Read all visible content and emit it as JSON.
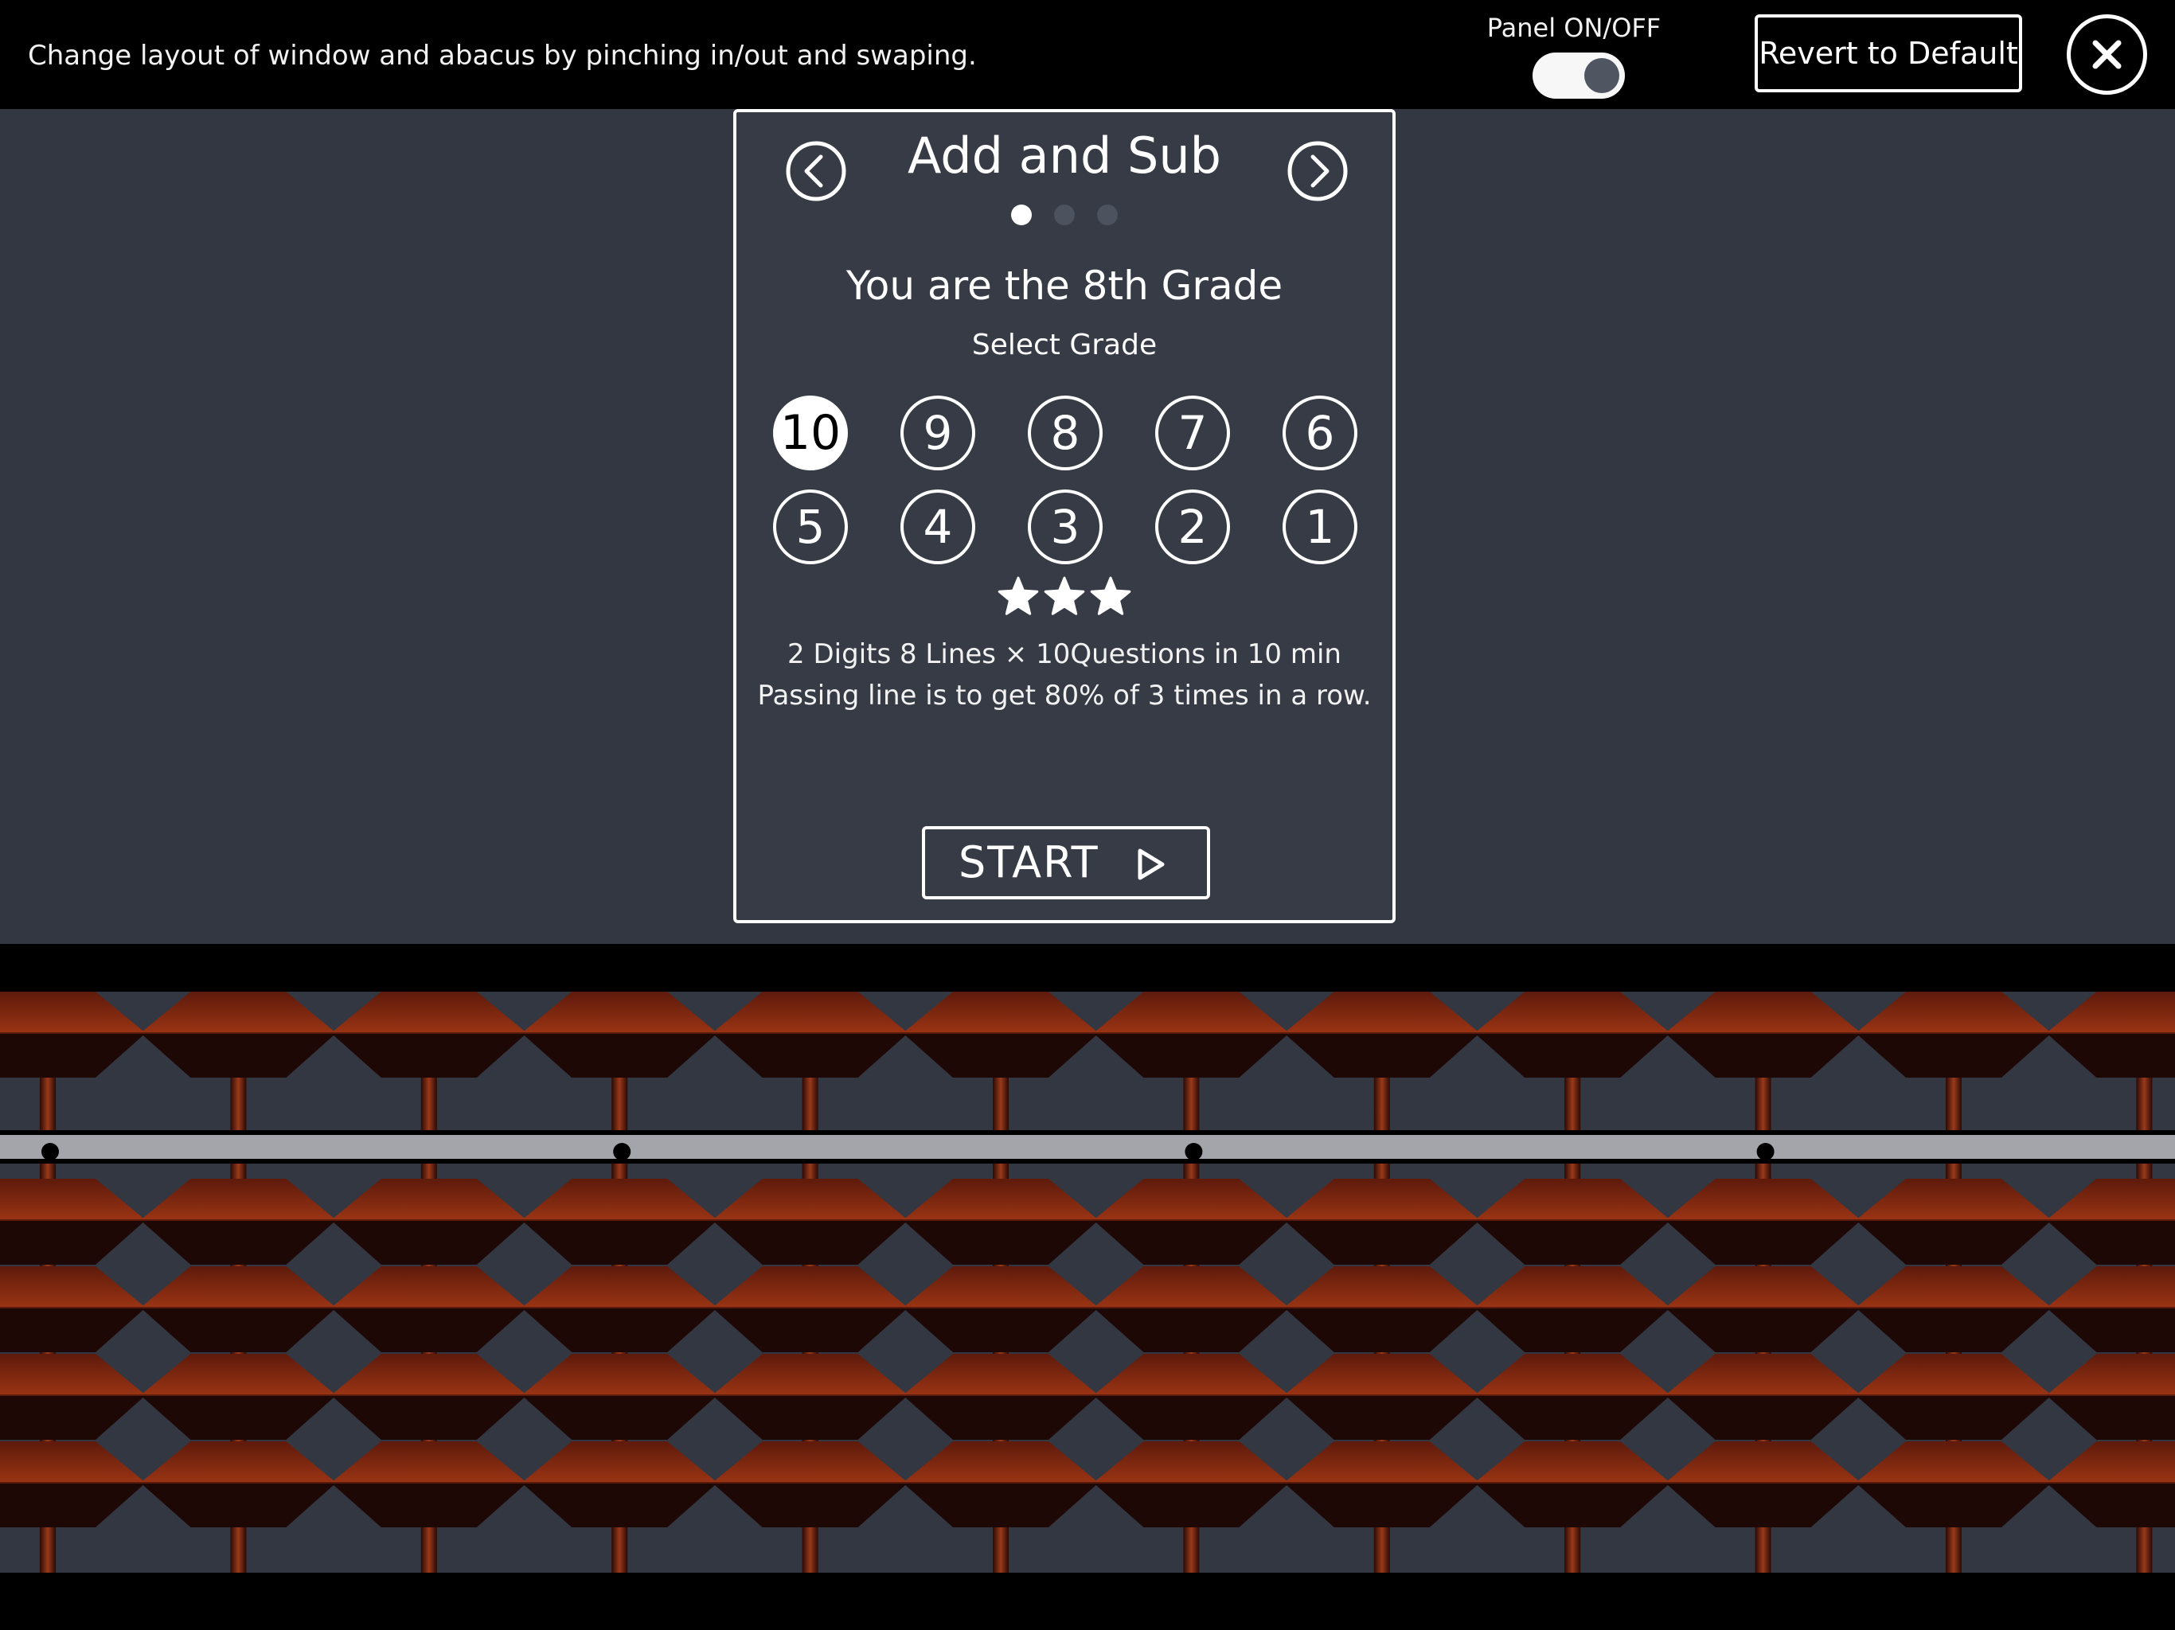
{
  "topbar": {
    "hint": "Change layout of window and abacus by pinching in/out and swaping.",
    "panel_label": "Panel ON/OFF",
    "panel_on": true,
    "revert_label": "Revert to Default",
    "close_icon": "close-icon"
  },
  "card": {
    "title": "Add and Sub",
    "page_count": 3,
    "active_page": 1,
    "grade_heading": "You are the 8th Grade",
    "select_label": "Select  Grade",
    "grades": [
      "10",
      "9",
      "8",
      "7",
      "6",
      "5",
      "4",
      "3",
      "2",
      "1"
    ],
    "selected_grade": "10",
    "star_count": 3,
    "desc_line1": "2 Digits  8 Lines × 10Questions  in  10 min",
    "desc_line2": "Passing line is to get 80% of 3 times in a row.",
    "start_label": "START"
  },
  "abacus": {
    "rods": 12,
    "upper_beads_per_rod": 1,
    "lower_beads_per_rod": 4,
    "unit_dot_count": 4,
    "bead_color": "#8b2a12",
    "bead_dark_color": "#1e0806",
    "frame_color": "#000000",
    "beam_color": "#a4a4ab"
  }
}
